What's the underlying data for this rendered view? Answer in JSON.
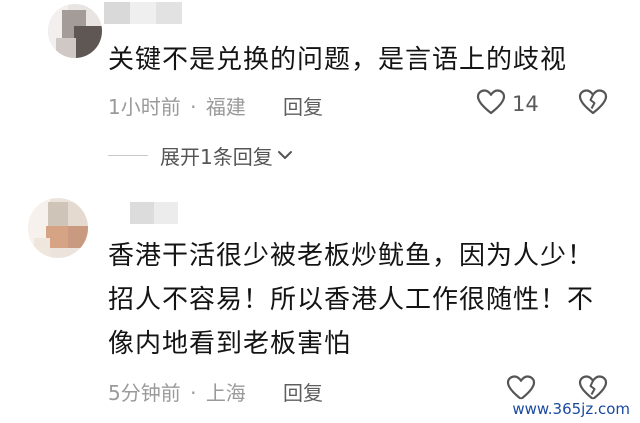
{
  "comments": [
    {
      "text_lines": [
        "关键不是兑换的问题，是言语上的歧视"
      ],
      "time": "1小时前",
      "dot": "·",
      "location": "福建",
      "reply_label": "回复",
      "likes": "14",
      "expand_label": "展开1条回复"
    },
    {
      "text_lines": [
        "香港干活很少被老板炒鱿鱼，因为人少！",
        "招人不容易！所以香港人工作很随性！不",
        "像内地看到老板害怕"
      ],
      "time": "5分钟前",
      "dot": "·",
      "location": "上海",
      "reply_label": "回复"
    }
  ],
  "watermark": "www.365jz.com",
  "icons": {
    "like": "heart-outline-icon",
    "dislike": "broken-heart-icon",
    "expand": "chevron-down-icon"
  },
  "colors": {
    "meta": "#9a9a9a",
    "text": "#141414",
    "watermark": "#1a4aa0"
  }
}
